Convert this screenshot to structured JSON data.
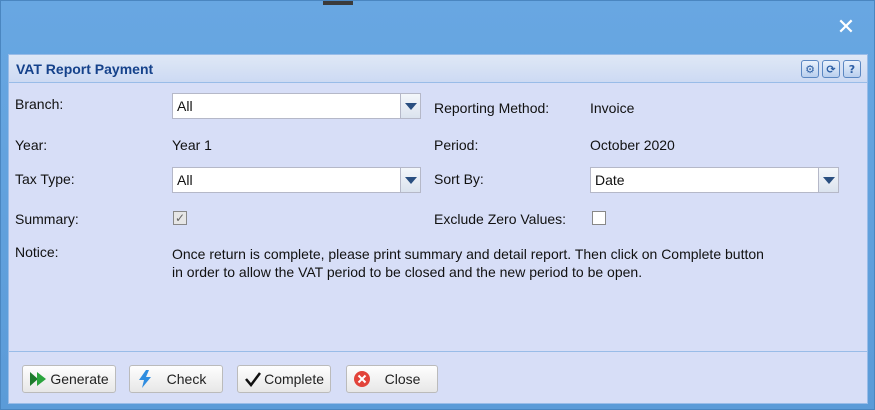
{
  "window": {
    "close_glyph": "✕"
  },
  "panel": {
    "title": "VAT Report Payment",
    "tools": [
      {
        "icon": "gear-icon",
        "glyph": "⚙"
      },
      {
        "icon": "refresh-icon",
        "glyph": "⟳"
      },
      {
        "icon": "help-icon",
        "glyph": "?"
      }
    ]
  },
  "form": {
    "branch": {
      "label": "Branch:",
      "value": "All"
    },
    "reporting_method": {
      "label": "Reporting Method:",
      "value": "Invoice"
    },
    "year": {
      "label": "Year:",
      "value": "Year 1"
    },
    "period": {
      "label": "Period:",
      "value": "October 2020"
    },
    "tax_type": {
      "label": "Tax Type:",
      "value": "All"
    },
    "sort_by": {
      "label": "Sort By:",
      "value": "Date"
    },
    "summary": {
      "label": "Summary:",
      "checked": true
    },
    "exclude_zero": {
      "label": "Exclude Zero Values:",
      "checked": false
    },
    "notice": {
      "label": "Notice:",
      "text": "Once return is complete, please print summary and detail report. Then click on Complete button in order to allow the VAT period to be closed and the new period to be open."
    }
  },
  "buttons": {
    "generate": "Generate",
    "check": "Check",
    "complete": "Complete",
    "close": "Close"
  },
  "colors": {
    "window_bg": "#5fa0dc",
    "panel_bg": "#d7def7",
    "title_color": "#15428b"
  }
}
